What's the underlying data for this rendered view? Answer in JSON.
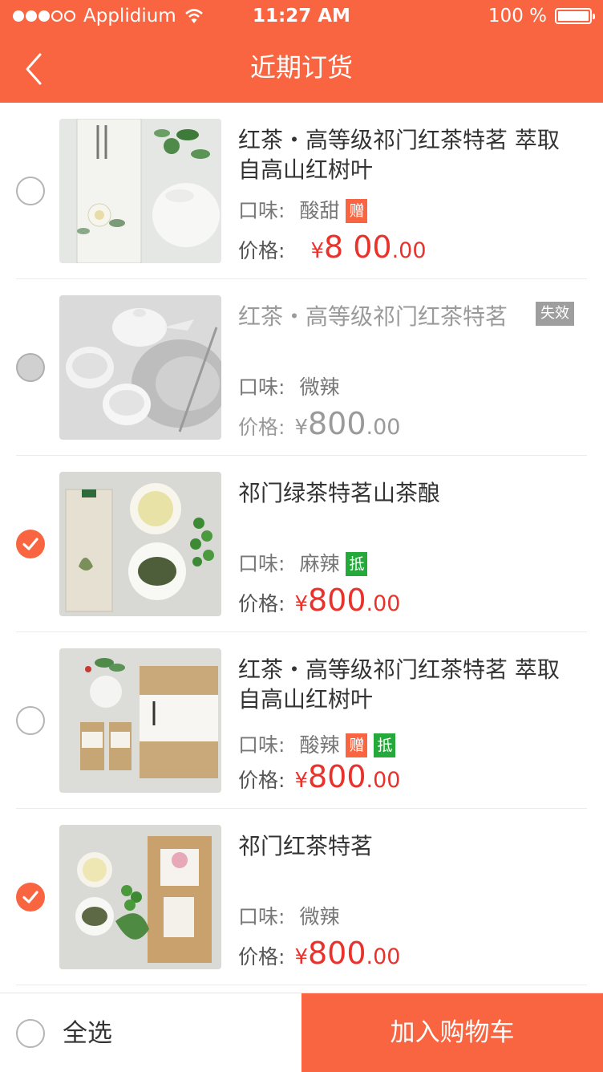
{
  "status_bar": {
    "carrier": "Applidium",
    "time": "11:27 AM",
    "battery": "100 %"
  },
  "nav": {
    "title": "近期订货"
  },
  "labels": {
    "flavor": "口味:",
    "price": "价格:",
    "currency": "¥"
  },
  "items": [
    {
      "title": "红茶・高等级祁门红茶特茗  萃取自高山红树叶",
      "flavor": "酸甜",
      "tags": [
        "赠"
      ],
      "price_main": "8 00",
      "price_cents": ".00",
      "state": "unchecked"
    },
    {
      "title": "红茶・高等级祁门红茶特茗",
      "invalid_tag": "失效",
      "flavor": "微辣",
      "tags": [],
      "price_main": "800",
      "price_cents": ".00",
      "state": "disabled"
    },
    {
      "title": "祁门绿茶特茗山茶酿",
      "flavor": "麻辣",
      "tags": [
        "抵"
      ],
      "price_main": "800",
      "price_cents": ".00",
      "state": "checked"
    },
    {
      "title": "红茶・高等级祁门红茶特茗  萃取自高山红树叶",
      "flavor": "酸辣",
      "tags": [
        "赠",
        "抵"
      ],
      "price_main": "800",
      "price_cents": ".00",
      "state": "unchecked"
    },
    {
      "title": "祁门红茶特茗",
      "flavor": "微辣",
      "tags": [],
      "price_main": "800",
      "price_cents": ".00",
      "state": "checked"
    }
  ],
  "bottom": {
    "select_all": "全选",
    "add_to_cart": "加入购物车"
  },
  "colors": {
    "brand": "#fa6541",
    "price_red": "#e8322b",
    "tag_green": "#25a93b",
    "tag_gray": "#9e9e9e"
  },
  "icons": {
    "back": "chevron-left-icon",
    "wifi": "wifi-icon",
    "battery": "battery-icon",
    "check": "checkmark-icon"
  }
}
